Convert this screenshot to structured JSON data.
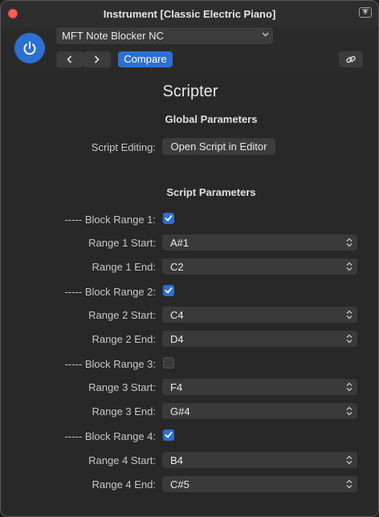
{
  "window": {
    "title": "Instrument [Classic Electric Piano]"
  },
  "header": {
    "preset_name": "MFT Note Blocker NC",
    "compare_label": "Compare"
  },
  "plugin": {
    "title": "Scripter",
    "global_section": "Global Parameters",
    "script_editing_label": "Script Editing:",
    "open_editor_label": "Open Script in Editor",
    "script_section": "Script Parameters"
  },
  "parameters": [
    {
      "label": "----- Block Range 1:",
      "type": "checkbox",
      "checked": true
    },
    {
      "label": "Range 1 Start:",
      "type": "select",
      "value": "A#1"
    },
    {
      "label": "Range 1 End:",
      "type": "select",
      "value": "C2"
    },
    {
      "label": "----- Block Range 2:",
      "type": "checkbox",
      "checked": true
    },
    {
      "label": "Range 2 Start:",
      "type": "select",
      "value": "C4"
    },
    {
      "label": "Range 2 End:",
      "type": "select",
      "value": "D4"
    },
    {
      "label": "----- Block Range 3:",
      "type": "checkbox",
      "checked": false
    },
    {
      "label": "Range 3 Start:",
      "type": "select",
      "value": "F4"
    },
    {
      "label": "Range 3 End:",
      "type": "select",
      "value": "G#4"
    },
    {
      "label": "----- Block Range 4:",
      "type": "checkbox",
      "checked": true
    },
    {
      "label": "Range 4 Start:",
      "type": "select",
      "value": "B4"
    },
    {
      "label": "Range 4 End:",
      "type": "select",
      "value": "C#5"
    }
  ],
  "colors": {
    "accent": "#2d6fd2",
    "background": "#282828",
    "close": "#ff5f57"
  }
}
